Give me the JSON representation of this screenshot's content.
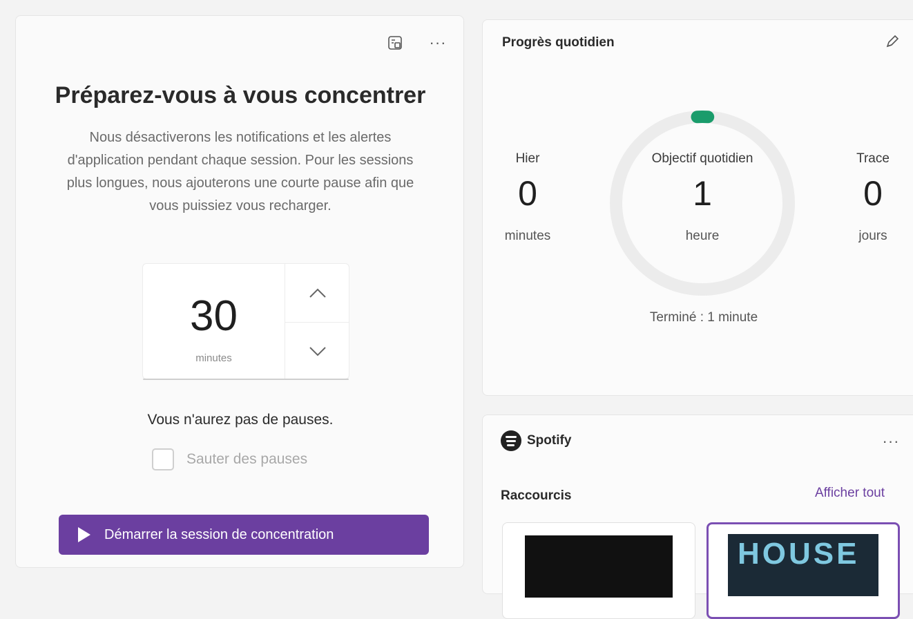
{
  "focus": {
    "title": "Préparez-vous à vous concentrer",
    "description": "Nous désactiverons les notifications et les alertes d'application pendant chaque session. Pour les sessions plus longues, nous ajouterons une courte pause afin que vous puissiez vous recharger.",
    "duration_value": "30",
    "duration_unit": "minutes",
    "breaks_text": "Vous n'aurez pas de pauses.",
    "skip_breaks_label": "Sauter des pauses",
    "skip_breaks_checked": false,
    "start_button_label": "Démarrer la session de concentration",
    "icons": [
      "screen-icon",
      "more-options-icon",
      "chevron-up-icon",
      "chevron-down-icon",
      "play-icon"
    ]
  },
  "progress": {
    "title": "Progrès quotidien",
    "yesterday": {
      "label": "Hier",
      "value": "0",
      "unit": "minutes"
    },
    "goal": {
      "label": "Objectif quotidien",
      "value": "1",
      "unit": "heure"
    },
    "streak": {
      "label": "Trace",
      "value": "0",
      "unit": "jours"
    },
    "completed_text": "Terminé : 1 minute",
    "goal_completion_fraction": 0.017,
    "accent_color": "#1a9c6b",
    "icons": [
      "edit-pencil-icon"
    ]
  },
  "spotify": {
    "name": "Spotify",
    "shortcuts_label": "Raccourcis",
    "view_all_label": "Afficher tout",
    "tile_2_art_text": "HOUSE",
    "accent_color": "#6b3fa0",
    "icons": [
      "spotify-logo-icon",
      "more-options-icon"
    ]
  }
}
